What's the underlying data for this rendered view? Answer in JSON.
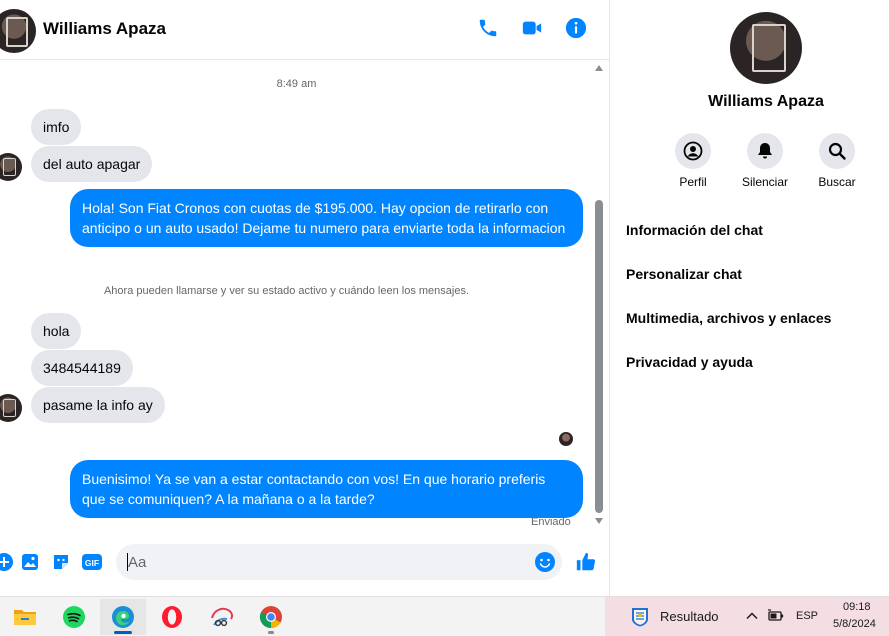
{
  "header": {
    "contact_name": "Williams Apaza",
    "icons": [
      "phone-icon",
      "video-call-icon",
      "info-icon"
    ]
  },
  "conversation": {
    "timestamp": "8:49 am",
    "incoming_group_1": [
      "imfo",
      "del auto apagar"
    ],
    "outgoing_1": "Hola! Son Fiat Cronos con cuotas de $195.000. Hay opcion de retirarlo con anticipo o un auto usado! Dejame tu numero para enviarte toda la informacion",
    "notice": "Ahora pueden llamarse y ver su estado activo y cuándo leen los mensajes.",
    "incoming_group_2": [
      "hola",
      "3484544189",
      "pasame la info ay"
    ],
    "outgoing_2": "Buenisimo! Ya se van a estar contactando con vos! En que horario preferis que se comuniquen? A la mañana o a la tarde?",
    "status": "Enviado"
  },
  "composer": {
    "placeholder": "Aa",
    "gif_label": "GIF",
    "icons": [
      "add-icon",
      "photo-icon",
      "sticker-icon",
      "gif-icon",
      "emoji-icon",
      "like-icon"
    ]
  },
  "info_panel": {
    "name": "Williams Apaza",
    "actions": [
      {
        "label": "Perfil",
        "icon": "profile-icon"
      },
      {
        "label": "Silenciar",
        "icon": "bell-icon"
      },
      {
        "label": "Buscar",
        "icon": "search-icon"
      }
    ],
    "links": [
      "Información del chat",
      "Personalizar chat",
      "Multimedia, archivos y enlaces",
      "Privacidad y ayuda"
    ]
  },
  "taskbar": {
    "apps": [
      "file-explorer-icon",
      "spotify-icon",
      "edge-icon",
      "opera-icon",
      "snipping-tool-icon",
      "chrome-icon"
    ],
    "widget_label": "Resultado",
    "language": "ESP",
    "time": "09:18",
    "date": "5/8/2024"
  },
  "colors": {
    "accent": "#0084ff",
    "incoming_bubble": "#e4e6eb",
    "tray_bg": "#f4dde3"
  }
}
